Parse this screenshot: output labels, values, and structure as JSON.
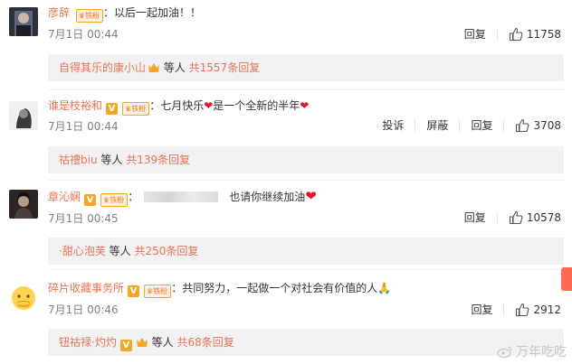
{
  "comments": [
    {
      "username": "彦辞",
      "fan_badge": "铁粉",
      "separator": "：",
      "text": "以后一起加油！！",
      "time": "7月1日 00:44",
      "reply_label": "回复",
      "likes": "11758",
      "thread": {
        "names": "自得其乐的康小山",
        "mid": " 等人 ",
        "count": "共1557条回复"
      }
    },
    {
      "username": "谁是枝裕和",
      "fan_badge": "铁粉",
      "separator": "：",
      "text_a": "七月快乐",
      "text_b": "是一个全新的半年",
      "time": "7月1日 00:44",
      "report_label": "投诉",
      "block_label": "屏蔽",
      "reply_label": "回复",
      "likes": "3708",
      "thread": {
        "names": "祜禮biu",
        "mid": " 等人 ",
        "count": "共139条回复"
      }
    },
    {
      "username": "章沁娴",
      "fan_badge": "铁粉",
      "separator": "：",
      "text": "也请你继续加油",
      "time": "7月1日 00:45",
      "reply_label": "回复",
      "likes": "10578",
      "thread": {
        "names": "·甜心泡芙",
        "mid": " 等人 ",
        "count": "共250条回复"
      }
    },
    {
      "username": "碎片收藏事务所",
      "fan_badge": "铁粉",
      "separator": "：",
      "text": "共同努力，一起做一个对社会有价值的人",
      "time": "7月1日 00:46",
      "reply_label": "回复",
      "likes": "2912",
      "thread": {
        "names": "钮祜禄·灼灼",
        "mid": " 等人 ",
        "count": "共68条回复"
      }
    }
  ],
  "watermark": "万年吃吃",
  "colors": {
    "accent": "#eb7350",
    "heart": "#e6162d",
    "badge": "#f5a623",
    "reply_bg": "#f2f2f5"
  }
}
